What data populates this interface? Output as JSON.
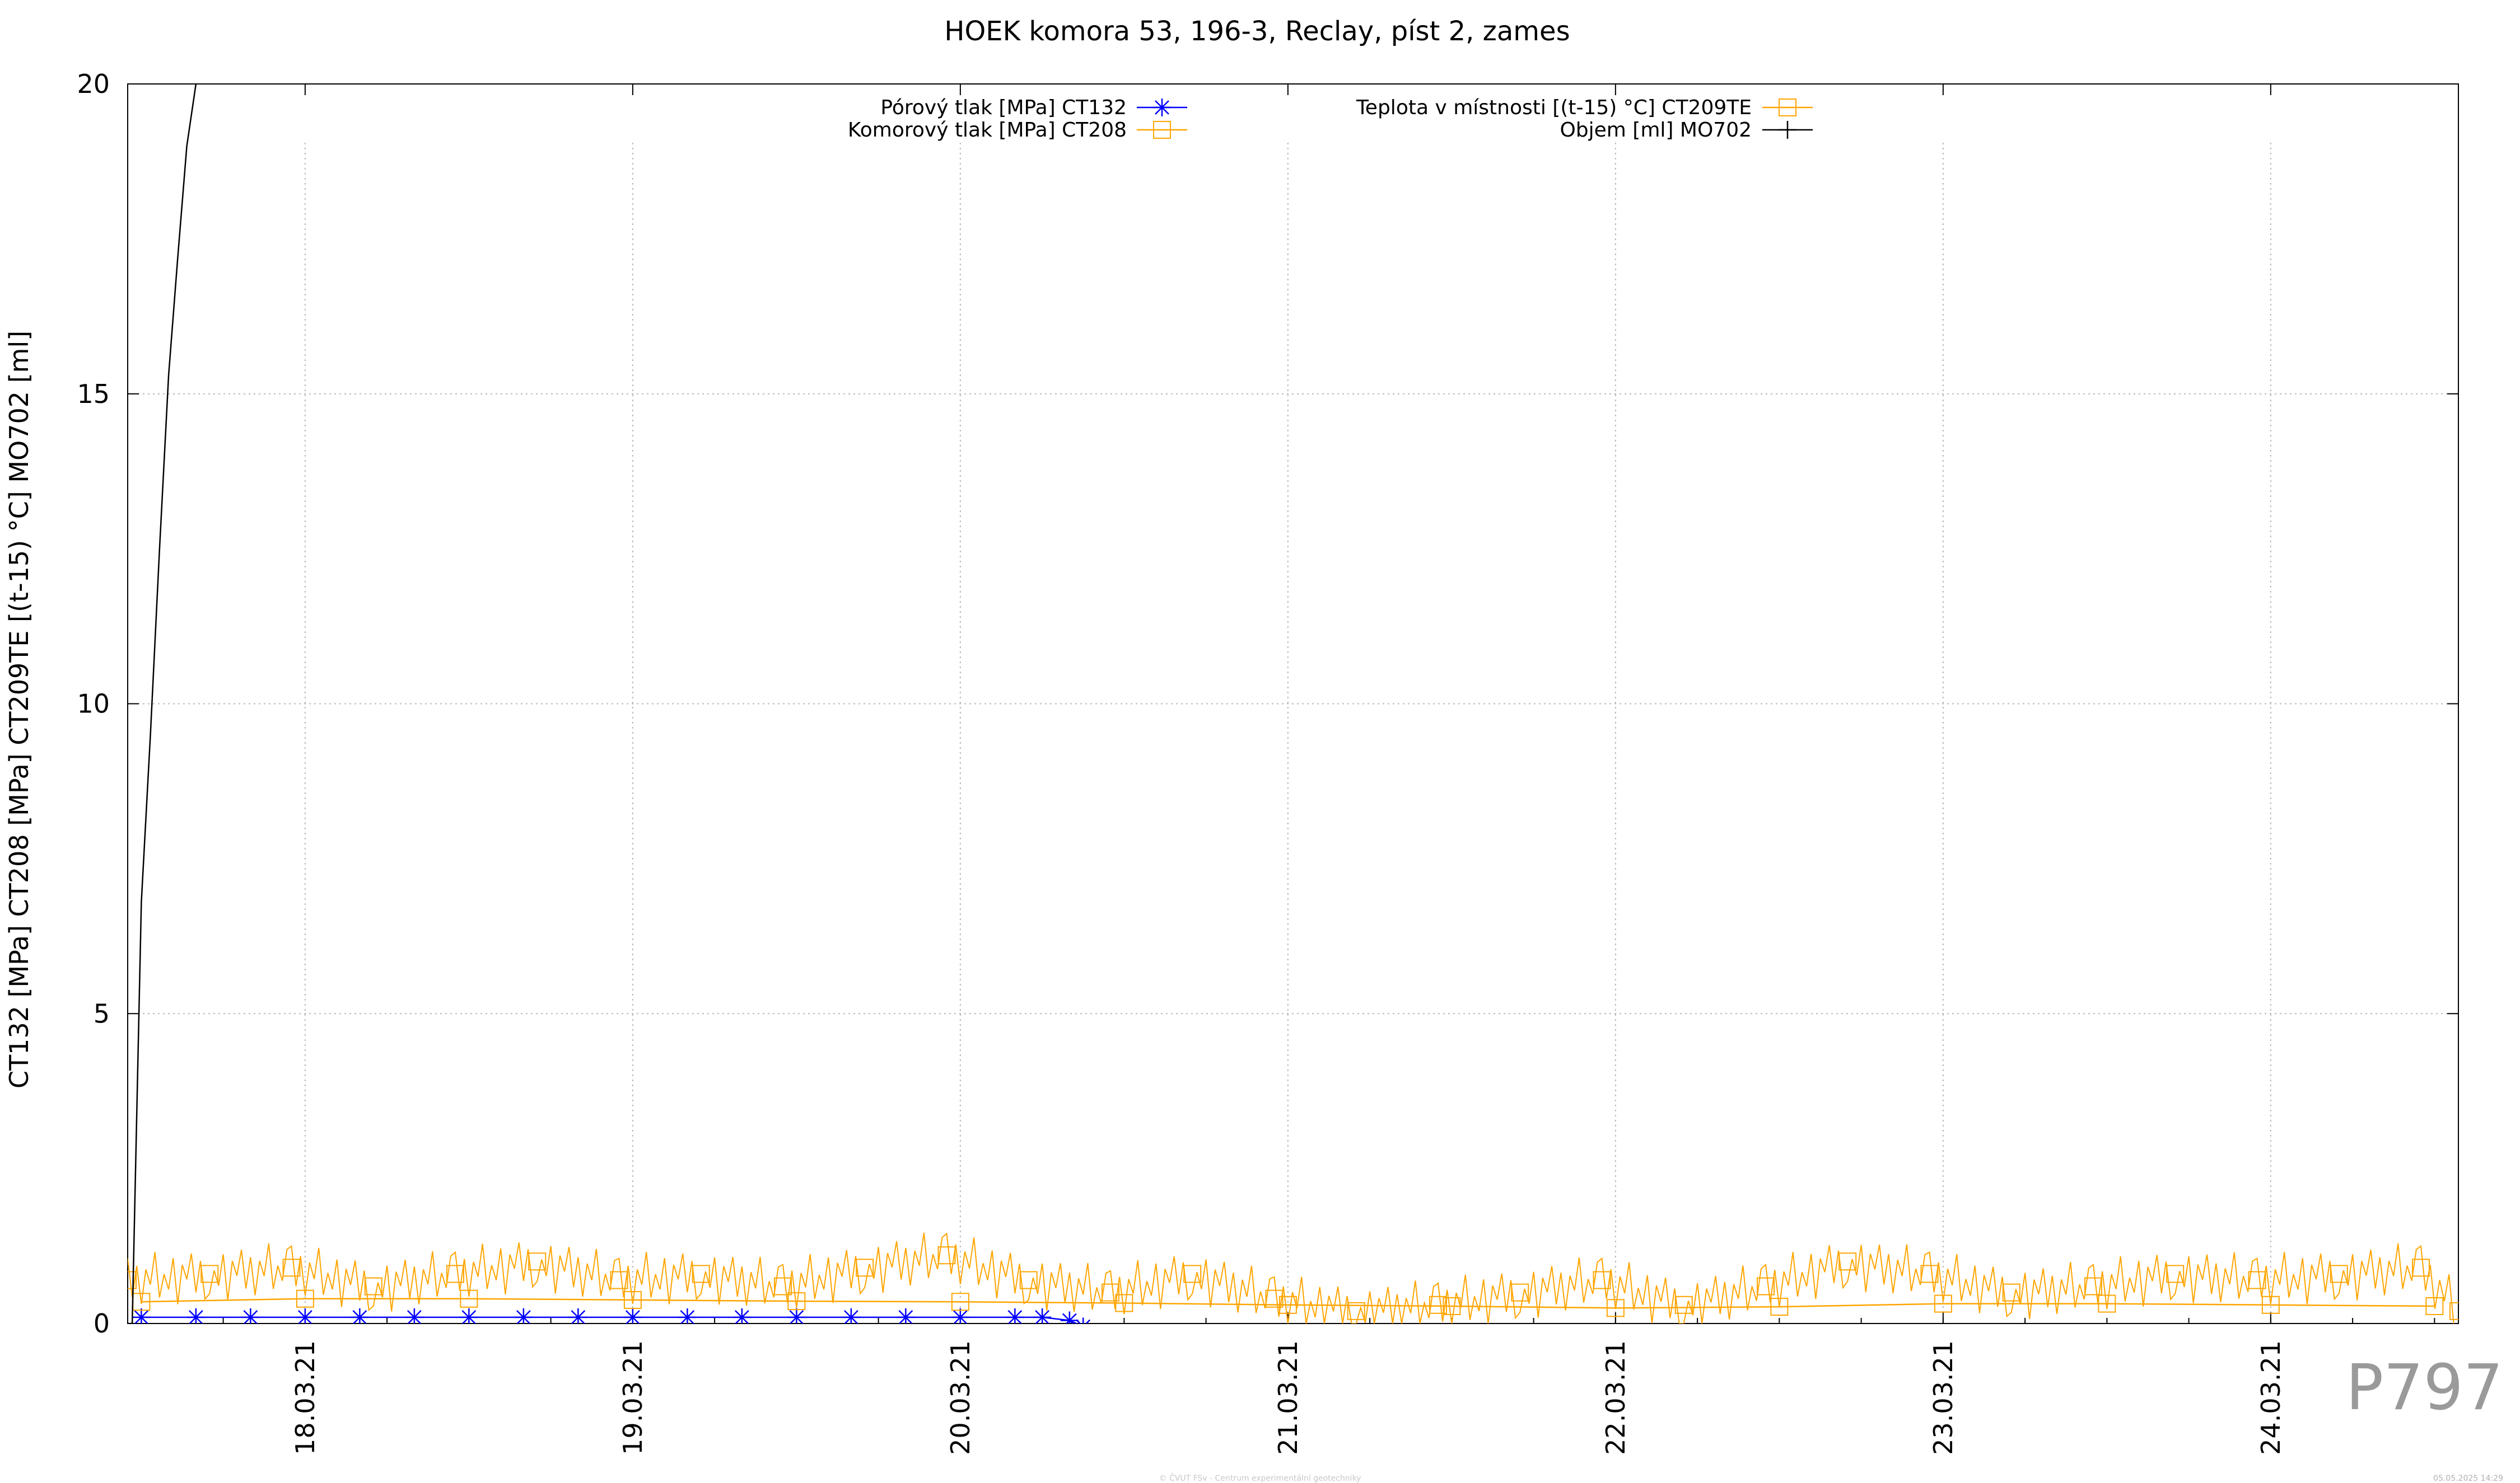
{
  "chart_data": {
    "type": "line",
    "title": "HOEK komora 53, 196-3, Reclay, píst 2, zames",
    "xlabel": "",
    "ylabel": "CT132 [MPa] CT208 [MPa] CT209TE [(t-15) °C] MO702 [ml]",
    "ylim": [
      0,
      20
    ],
    "yticks": [
      "0",
      "5",
      "10",
      "15",
      "20"
    ],
    "xlim": [
      "2021-03-17T11:00",
      "2021-03-24T13:45"
    ],
    "xticks": [
      {
        "x": "2021-03-18",
        "label": "18.03.21"
      },
      {
        "x": "2021-03-19",
        "label": "19.03.21"
      },
      {
        "x": "2021-03-20",
        "label": "20.03.21"
      },
      {
        "x": "2021-03-21",
        "label": "21.03.21"
      },
      {
        "x": "2021-03-22",
        "label": "22.03.21"
      },
      {
        "x": "2021-03-23",
        "label": "23.03.21"
      },
      {
        "x": "2021-03-24",
        "label": "24.03.21"
      }
    ],
    "grid": true,
    "legend_position": "top",
    "series": [
      {
        "name": "Pórový tlak [MPa] CT132",
        "color": "#0000ff",
        "marker": "asterisk",
        "x": [
          "2021-03-17T12:00",
          "2021-03-17T16:00",
          "2021-03-17T20:00",
          "2021-03-18T00:00",
          "2021-03-18T04:00",
          "2021-03-18T08:00",
          "2021-03-18T12:00",
          "2021-03-18T16:00",
          "2021-03-18T20:00",
          "2021-03-19T00:00",
          "2021-03-19T04:00",
          "2021-03-19T08:00",
          "2021-03-19T12:00",
          "2021-03-19T16:00",
          "2021-03-19T20:00",
          "2021-03-20T00:00",
          "2021-03-20T04:00",
          "2021-03-20T06:00",
          "2021-03-20T08:00",
          "2021-03-20T09:00"
        ],
        "values": [
          0.1,
          0.1,
          0.1,
          0.1,
          0.1,
          0.1,
          0.1,
          0.1,
          0.1,
          0.1,
          0.1,
          0.1,
          0.1,
          0.1,
          0.1,
          0.1,
          0.1,
          0.1,
          0.05,
          -0.05
        ]
      },
      {
        "name": "Komorový tlak [MPa] CT208",
        "color": "#ffa500",
        "marker": "square",
        "x": [
          "2021-03-17T12:00",
          "2021-03-18T00:00",
          "2021-03-18T12:00",
          "2021-03-19T00:00",
          "2021-03-19T12:00",
          "2021-03-20T00:00",
          "2021-03-20T12:00",
          "2021-03-21T00:00",
          "2021-03-21T12:00",
          "2021-03-22T00:00",
          "2021-03-22T12:00",
          "2021-03-23T00:00",
          "2021-03-23T12:00",
          "2021-03-24T00:00",
          "2021-03-24T12:00"
        ],
        "values": [
          0.35,
          0.4,
          0.4,
          0.38,
          0.36,
          0.35,
          0.33,
          0.3,
          0.28,
          0.25,
          0.27,
          0.32,
          0.32,
          0.3,
          0.28
        ]
      },
      {
        "name": "Teplota v místnosti [(t-15) °C] CT209TE",
        "color": "#ffa500",
        "marker": "square",
        "x": [
          "2021-03-17T11:00",
          "2021-03-17T17:00",
          "2021-03-17T23:00",
          "2021-03-18T05:00",
          "2021-03-18T11:00",
          "2021-03-18T17:00",
          "2021-03-18T23:00",
          "2021-03-19T05:00",
          "2021-03-19T11:00",
          "2021-03-19T17:00",
          "2021-03-19T23:00",
          "2021-03-20T05:00",
          "2021-03-20T11:00",
          "2021-03-20T17:00",
          "2021-03-20T23:00",
          "2021-03-21T05:00",
          "2021-03-21T11:00",
          "2021-03-21T17:00",
          "2021-03-21T23:00",
          "2021-03-22T05:00",
          "2021-03-22T11:00",
          "2021-03-22T17:00",
          "2021-03-22T23:00",
          "2021-03-23T05:00",
          "2021-03-23T11:00",
          "2021-03-23T17:00",
          "2021-03-23T23:00",
          "2021-03-24T05:00",
          "2021-03-24T11:00",
          "2021-03-24T13:45"
        ],
        "values": [
          0.7,
          0.8,
          0.9,
          0.6,
          0.8,
          1.0,
          0.7,
          0.8,
          0.6,
          0.9,
          1.1,
          0.7,
          0.5,
          0.8,
          0.4,
          0.2,
          0.3,
          0.5,
          0.7,
          0.3,
          0.6,
          1.0,
          0.8,
          0.5,
          0.6,
          0.8,
          0.7,
          0.8,
          0.9,
          0.2
        ]
      },
      {
        "name": "Objem [ml] MO702",
        "color": "#000000",
        "marker": "plus",
        "x": [
          "2021-03-17T11:00",
          "2021-03-17T11:20",
          "2021-03-17T12:00",
          "2021-03-17T12:40",
          "2021-03-17T13:20",
          "2021-03-17T14:00",
          "2021-03-17T14:40",
          "2021-03-17T15:20",
          "2021-03-17T16:00"
        ],
        "values": [
          0.0,
          0.0,
          6.8,
          9.5,
          12.5,
          15.3,
          17.2,
          19.0,
          20.0
        ]
      }
    ]
  },
  "plot_id": "P797",
  "footer": {
    "credit": "© ČVUT FSv - Centrum experimentální geotechniky",
    "date": "05.05.2025 14:29"
  }
}
